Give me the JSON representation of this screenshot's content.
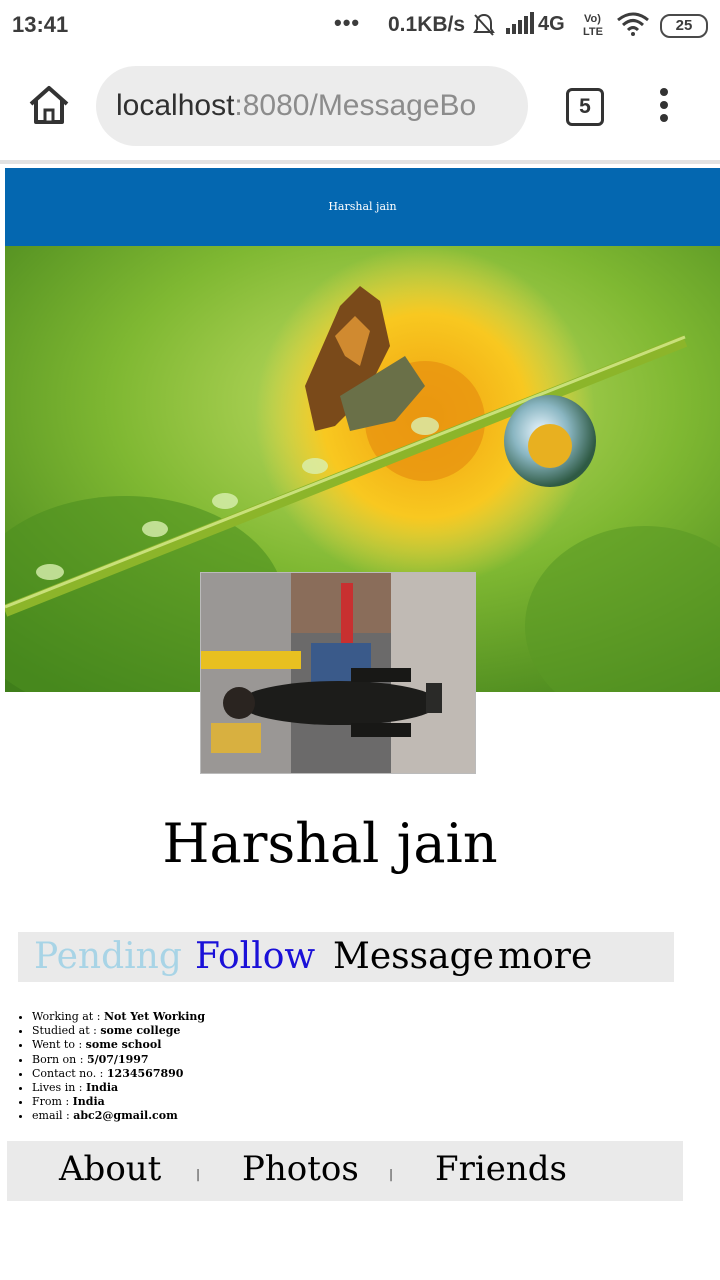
{
  "status_bar": {
    "time": "13:41",
    "dots": "•••",
    "speed": "0.1KB/s",
    "network": "4G",
    "volte": "Vo LTE",
    "battery": "25"
  },
  "browser": {
    "url_host": "localhost",
    "url_path": ":8080/MessageBo",
    "tab_count": "5"
  },
  "page": {
    "header_title": "Harshal jain",
    "profile_name": "Harshal jain",
    "actions": {
      "pending": "Pending",
      "follow": "Follow",
      "message": "Message",
      "more": "more"
    },
    "info": [
      {
        "label": "Working at : ",
        "value": "Not Yet Working"
      },
      {
        "label": "Studied at : ",
        "value": "some college"
      },
      {
        "label": "Went to : ",
        "value": "some school"
      },
      {
        "label": "Born on : ",
        "value": "5/07/1997"
      },
      {
        "label": "Contact no. : ",
        "value": "1234567890"
      },
      {
        "label": "Lives in : ",
        "value": "India"
      },
      {
        "label": "From : ",
        "value": "India"
      },
      {
        "label": "email : ",
        "value": "abc2@gmail.com"
      }
    ],
    "nav": {
      "about": "About",
      "photos": "Photos",
      "friends": "Friends",
      "separator": "|"
    }
  },
  "colors": {
    "header_bg": "#0467b0",
    "pending": "#a8d4e6",
    "follow": "#1a10d8",
    "bar_bg": "#eaeaea"
  },
  "icons": [
    "home-icon",
    "tabs-icon",
    "menu-icon",
    "mute-icon",
    "signal-icon",
    "wifi-icon",
    "battery-icon"
  ]
}
